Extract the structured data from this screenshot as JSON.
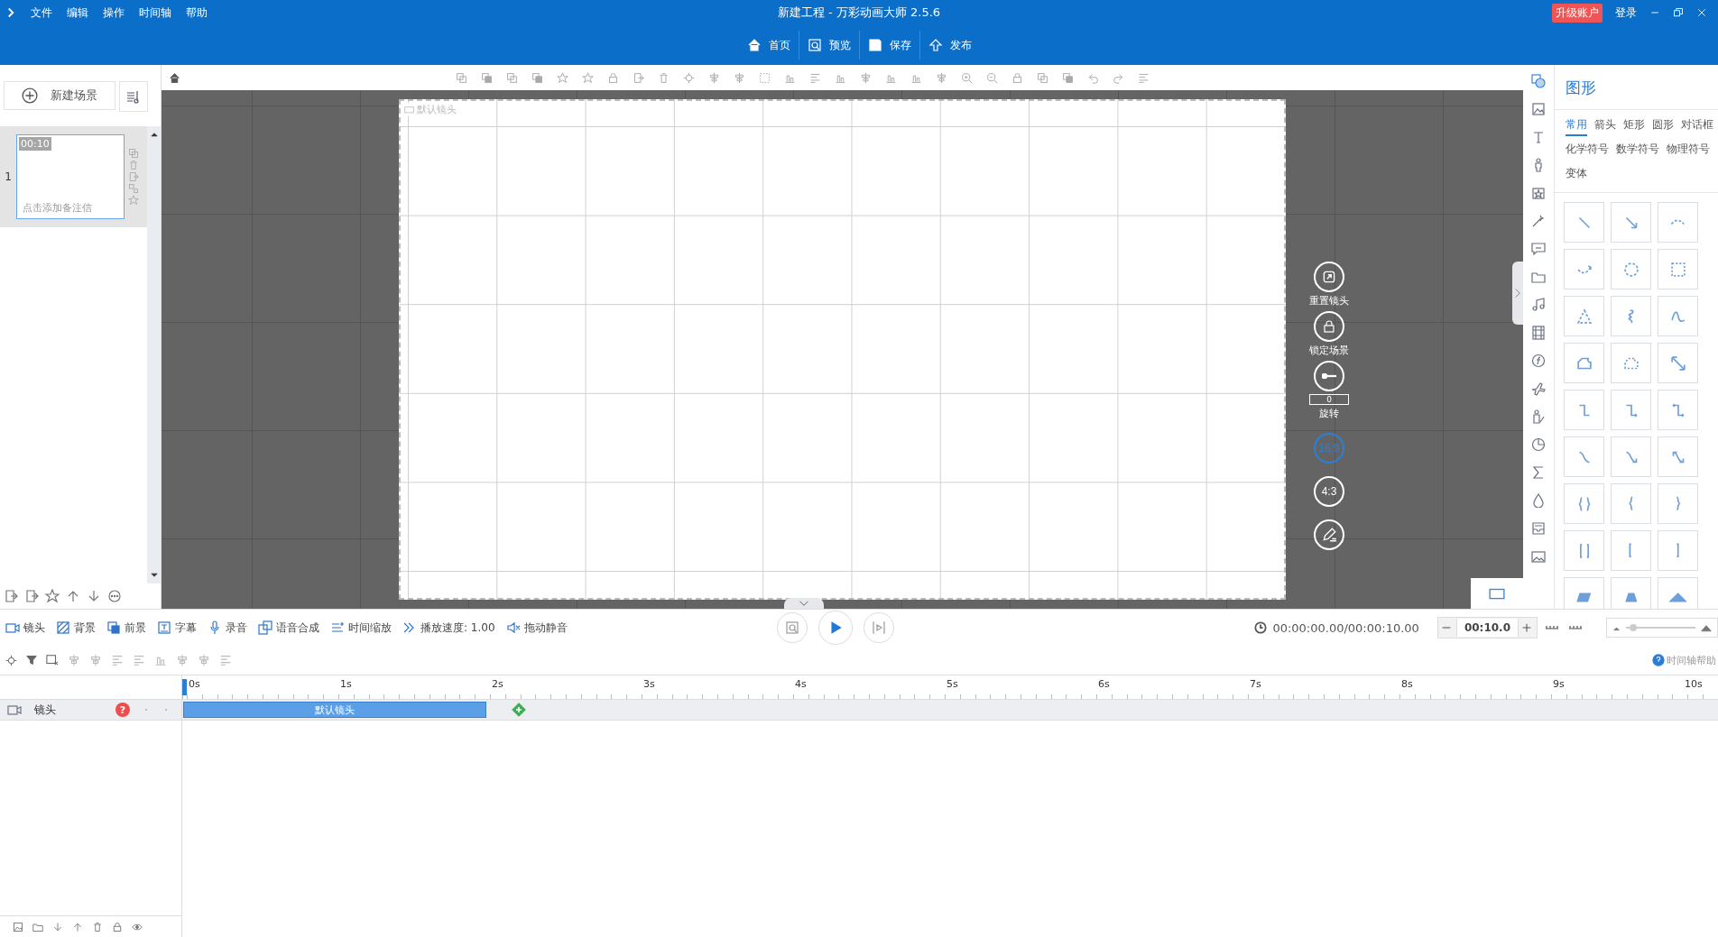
{
  "menu": [
    "文件",
    "编辑",
    "操作",
    "时间轴",
    "帮助"
  ],
  "window": {
    "title": "新建工程 - 万彩动画大师 2.5.6"
  },
  "account": {
    "upgrade": "升级账户",
    "login": "登录"
  },
  "main_toolbar": [
    "首页",
    "预览",
    "保存",
    "发布"
  ],
  "scenes": {
    "new_scene": "新建场景",
    "items": [
      {
        "number": "1",
        "duration": "00:10",
        "note": "点击添加备注信",
        "selected": true
      }
    ]
  },
  "stage": {
    "camera_label": "默认镜头"
  },
  "camera_controls": {
    "reset": "重置镜头",
    "lock": "锁定场景",
    "rotation_value": "0",
    "rotate": "旋转",
    "ratios": [
      {
        "label": "16:9",
        "selected": true
      },
      {
        "label": "4:3",
        "selected": false
      }
    ]
  },
  "panel": {
    "title": "图形",
    "categories": [
      {
        "label": "常用",
        "selected": true
      },
      {
        "label": "箭头",
        "selected": false
      },
      {
        "label": "矩形",
        "selected": false
      },
      {
        "label": "圆形",
        "selected": false
      },
      {
        "label": "对话框",
        "selected": false
      },
      {
        "label": "化学符号",
        "selected": false
      },
      {
        "label": "数学符号",
        "selected": false
      },
      {
        "label": "物理符号",
        "selected": false
      },
      {
        "label": "变体",
        "selected": false
      }
    ]
  },
  "timeline": {
    "tools": [
      {
        "label": "镜头",
        "kind": "camera"
      },
      {
        "label": "背景",
        "kind": "background"
      },
      {
        "label": "前景",
        "kind": "foreground"
      },
      {
        "label": "字幕",
        "kind": "subtitle"
      },
      {
        "label": "录音",
        "kind": "mic"
      },
      {
        "label": "语音合成",
        "kind": "tts"
      },
      {
        "label": "时间缩放",
        "kind": "scale"
      },
      {
        "label": "播放速度: 1.00",
        "kind": "speed"
      },
      {
        "label": "拖动静音",
        "kind": "mute"
      }
    ],
    "time": "00:00:00.00/00:00:10.00",
    "duration": "00:10.0",
    "zoom": {
      "level": 0.05
    },
    "help": "时间轴帮助",
    "ticks": [
      "0s",
      "1s",
      "2s",
      "3s",
      "4s",
      "5s",
      "6s",
      "7s",
      "8s",
      "9s",
      "10s"
    ],
    "tracks": [
      {
        "name": "镜头",
        "help_mark": "?",
        "clip": {
          "label": "默认镜头",
          "level": 0.2
        }
      }
    ]
  }
}
